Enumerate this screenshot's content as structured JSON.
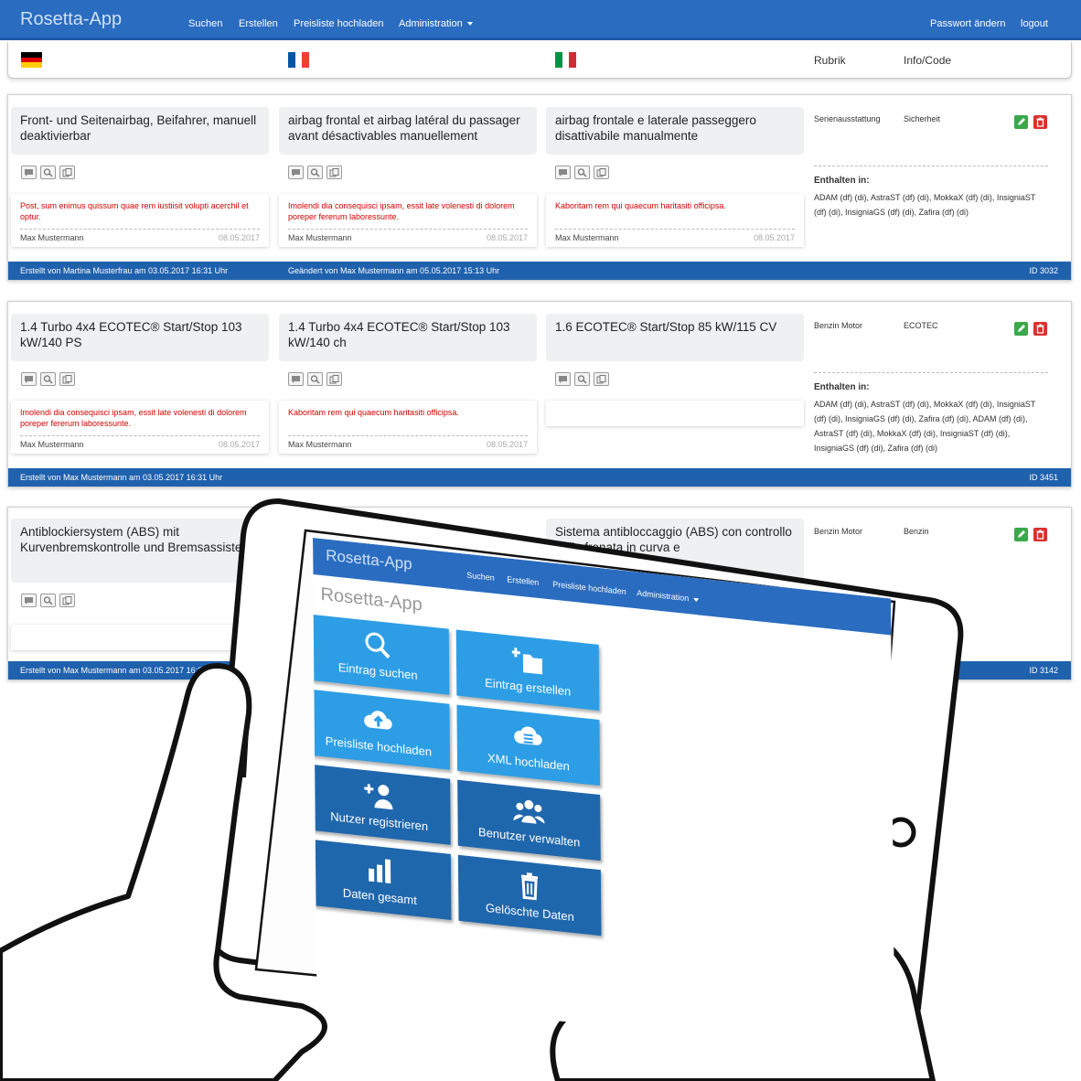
{
  "app": {
    "brand": "Rosetta-App",
    "nav": {
      "suchen": "Suchen",
      "erstellen": "Erstellen",
      "preisliste": "Preisliste hochladen",
      "administration": "Administration",
      "passwort": "Passwort ändern",
      "logout": "logout"
    },
    "columns": {
      "rubrik": "Rubrik",
      "info": "Info/Code"
    },
    "enthalten_label": "Enthalten in:",
    "entries": [
      {
        "de": "Front- und Seitenairbag, Beifahrer, manuell deaktivierbar",
        "fr": "airbag frontal et airbag latéral du passager avant désactivables manuellement",
        "it": "airbag frontale e laterale passeggero disattivabile manualmente",
        "rubrik": "Serienausstattung",
        "info": "Sicherheit",
        "enthalten": "ADAM (df) (di), AstraST (df) (di), MokkaX (df) (di), InsigniaST (df) (di), InsigniaGS (df) (di), Zafira (df) (di)",
        "comments": [
          {
            "text": "Post, sum enimus quissum quae rem iustiisit volupti acerchil et optur.",
            "author": "Max Mustermann",
            "date": "08.05.2017"
          },
          {
            "text": "Imolendi dia consequisci ipsam, essit late volenesti di dolorem poreper fererum laboressunte.",
            "author": "Max Mustermann",
            "date": "08.05.2017"
          },
          {
            "text": "Kaboritam rem qui quaecum haritasiti officipsa.",
            "author": "Max Mustermann",
            "date": "08.05.2017"
          }
        ],
        "created": "Erstellt von Martina Musterfrau am 03.05.2017 16:31 Uhr",
        "changed": "Geändert von Max Mustermann am 05.05.2017 15:13 Uhr",
        "id": "ID 3032"
      },
      {
        "de": "1.4 Turbo 4x4 ECOTEC® Start/Stop 103 kW/140 PS",
        "fr": "1.4 Turbo 4x4 ECOTEC® Start/Stop 103 kW/140 ch",
        "it": "1.6 ECOTEC® Start/Stop 85 kW/115 CV",
        "rubrik": "Benzin Motor",
        "info": "ECOTEC",
        "enthalten": "ADAM (df) (di), AstraST (df) (di), MokkaX (df) (di), InsigniaST (df) (di), InsigniaGS (df) (di), Zafira (df) (di), ADAM (df) (di), AstraST (df) (di), MokkaX (df) (di), InsigniaST (df) (di), InsigniaGS (df) (di), Zafira (df) (di)",
        "comments": [
          {
            "text": "Imolendi dia consequisci ipsam, essit late volenesti di dolorem poreper fererum laboressunte.",
            "author": "Max Mustermann",
            "date": "08.05.2017"
          },
          {
            "text": "Kaboritam rem qui quaecum haritasiti officipsa.",
            "author": "Max Mustermann",
            "date": "08.05.2017"
          }
        ],
        "created": "Erstellt von Max Mustermann am 03.05.2017 16:31 Uhr",
        "id": "ID 3451"
      },
      {
        "de": "Antiblockiersystem (ABS) mit Kurvenbremskontrolle und Bremsassistent",
        "it": "Sistema antibloccaggio (ABS) con controllo della frenata in curva e",
        "rubrik": "Benzin Motor",
        "info": "Benzin",
        "created": "Erstellt von Max Mustermann am 03.05.2017 16:31",
        "id": "ID 3142"
      }
    ]
  },
  "tablet": {
    "brand": "Rosetta-App",
    "nav": {
      "suchen": "Suchen",
      "erstellen": "Erstellen",
      "preisliste": "Preisliste hochladen",
      "administration": "Administration"
    },
    "title": "Rosetta-App",
    "tiles": [
      {
        "label": "Eintrag suchen",
        "icon": "search-icon"
      },
      {
        "label": "Eintrag erstellen",
        "icon": "folder-plus-icon"
      },
      {
        "label": "Preisliste hochladen",
        "icon": "cloud-upload-icon"
      },
      {
        "label": "XML hochladen",
        "icon": "cloud-list-icon"
      },
      {
        "label": "Nutzer registrieren",
        "icon": "user-plus-icon"
      },
      {
        "label": "Benutzer verwalten",
        "icon": "users-icon"
      },
      {
        "label": "Daten gesamt",
        "icon": "bar-chart-icon"
      },
      {
        "label": "Gelöschte Daten",
        "icon": "trash-icon"
      }
    ]
  },
  "colors": {
    "nav_blue": "#2a6cc0",
    "footer_blue": "#1f61ad",
    "tile_light": "#2d9ee5",
    "tile_dark": "#1f67ad",
    "comment_red": "#d40000",
    "edit_green": "#3aa84b",
    "delete_red": "#d9312c"
  }
}
